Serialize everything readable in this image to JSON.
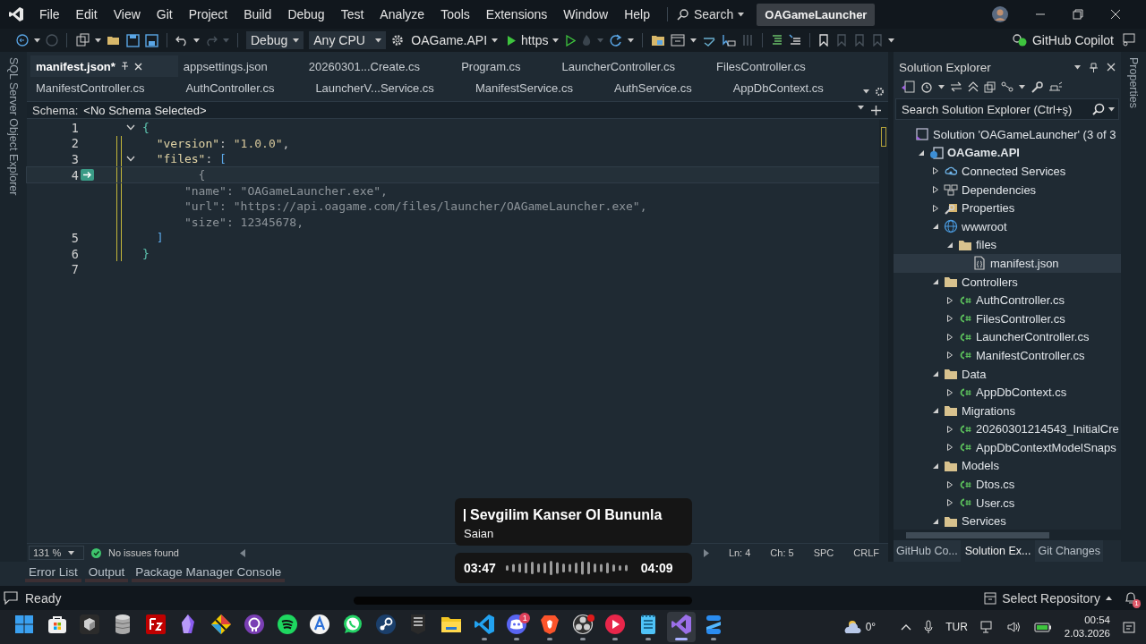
{
  "title_bar": {
    "menu": [
      "File",
      "Edit",
      "View",
      "Git",
      "Project",
      "Build",
      "Debug",
      "Test",
      "Analyze",
      "Tools",
      "Extensions",
      "Window",
      "Help"
    ],
    "search": "Search",
    "solution_name": "OAGameLauncher"
  },
  "toolbar": {
    "configuration": "Debug",
    "platform": "Any CPU",
    "startup_project": "OAGame.API",
    "launch_profile": "https",
    "copilot": "GitHub Copilot"
  },
  "left_strip": "SQL Server Object Explorer",
  "editor_tabs": [
    {
      "label": "manifest.json*",
      "selected": true
    },
    {
      "label": "appsettings.json",
      "selected": false
    },
    {
      "label": "20260301...Create.cs",
      "selected": false
    },
    {
      "label": "Program.cs",
      "selected": false
    },
    {
      "label": "LauncherController.cs",
      "selected": false
    },
    {
      "label": "FilesController.cs",
      "selected": false
    },
    {
      "label": "ManifestController.cs",
      "selected": false
    },
    {
      "label": "AuthController.cs",
      "selected": false
    },
    {
      "label": "LauncherV...Service.cs",
      "selected": false
    },
    {
      "label": "ManifestService.cs",
      "selected": false
    },
    {
      "label": "AuthService.cs",
      "selected": false
    },
    {
      "label": "AppDbContext.cs",
      "selected": false
    }
  ],
  "schema": {
    "label": "Schema:",
    "value": "<No Schema Selected>"
  },
  "code_lines": [
    {
      "number": "1",
      "kind": "code",
      "current": false,
      "changed": false,
      "expanded": true,
      "tokens": [
        {
          "text": "{",
          "kind": "brace"
        }
      ]
    },
    {
      "number": "2",
      "kind": "code",
      "current": false,
      "changed": true,
      "tokens": [
        {
          "text": "  \"version\"",
          "kind": "key"
        },
        {
          "text": ": ",
          "kind": "punct"
        },
        {
          "text": "\"1.0.0\"",
          "kind": "string"
        },
        {
          "text": ",",
          "kind": "punct"
        }
      ]
    },
    {
      "number": "3",
      "kind": "code",
      "current": false,
      "changed": true,
      "expanded": true,
      "tokens": [
        {
          "text": "  \"files\"",
          "kind": "key"
        },
        {
          "text": ": ",
          "kind": "punct"
        },
        {
          "text": "[",
          "kind": "bracket"
        }
      ]
    },
    {
      "number": "4",
      "kind": "suggestion",
      "current": true,
      "changed": true,
      "text": "        {"
    },
    {
      "kind": "suggestion",
      "current": false,
      "changed": true,
      "text": "      \"name\": \"OAGameLauncher.exe\","
    },
    {
      "kind": "suggestion",
      "current": false,
      "changed": true,
      "text": "      \"url\": \"https://api.oagame.com/files/launcher/OAGameLauncher.exe\","
    },
    {
      "kind": "suggestion",
      "current": false,
      "changed": true,
      "text": "      \"size\": 12345678,"
    },
    {
      "number": "5",
      "kind": "code",
      "current": false,
      "changed": true,
      "tokens": [
        {
          "text": "  ]",
          "kind": "bracket"
        }
      ]
    },
    {
      "number": "6",
      "kind": "code",
      "current": false,
      "changed": true,
      "tokens": [
        {
          "text": "}",
          "kind": "brace"
        }
      ]
    },
    {
      "number": "7",
      "kind": "code",
      "current": false,
      "changed": false
    }
  ],
  "editor_status": {
    "zoom": "131 %",
    "issues": "No issues found",
    "line": "Ln: 4",
    "column": "Ch: 5",
    "whitespace": "SPC",
    "line_ending": "CRLF"
  },
  "solution_explorer": {
    "title": "Solution Explorer",
    "search_placeholder": "Search Solution Explorer (Ctrl+ş)",
    "tree": [
      {
        "label": "Solution 'OAGameLauncher' (3 of 3",
        "kind": "solution",
        "selected": false,
        "children": [
          {
            "label": "OAGame.API",
            "kind": "project",
            "expanded": true,
            "selected": false,
            "children": [
              {
                "label": "Connected Services",
                "kind": "cloud",
                "expanded": false,
                "selected": false
              },
              {
                "label": "Dependencies",
                "kind": "deps",
                "expanded": false,
                "selected": false
              },
              {
                "label": "Properties",
                "kind": "wrench",
                "expanded": false,
                "selected": false
              },
              {
                "label": "wwwroot",
                "kind": "globe",
                "expanded": true,
                "selected": false,
                "children": [
                  {
                    "label": "files",
                    "kind": "folder",
                    "expanded": true,
                    "selected": false,
                    "children": [
                      {
                        "label": "manifest.json",
                        "kind": "json",
                        "selected": true
                      }
                    ]
                  }
                ]
              },
              {
                "label": "Controllers",
                "kind": "folder",
                "expanded": true,
                "selected": false,
                "children": [
                  {
                    "label": "AuthController.cs",
                    "kind": "csharp",
                    "expanded": false,
                    "selected": false
                  },
                  {
                    "label": "FilesController.cs",
                    "kind": "csharp",
                    "expanded": false,
                    "selected": false
                  },
                  {
                    "label": "LauncherController.cs",
                    "kind": "csharp",
                    "expanded": false,
                    "selected": false
                  },
                  {
                    "label": "ManifestController.cs",
                    "kind": "csharp",
                    "expanded": false,
                    "selected": false
                  }
                ]
              },
              {
                "label": "Data",
                "kind": "folder",
                "expanded": true,
                "selected": false,
                "children": [
                  {
                    "label": "AppDbContext.cs",
                    "kind": "csharp",
                    "expanded": false,
                    "selected": false
                  }
                ]
              },
              {
                "label": "Migrations",
                "kind": "folder",
                "expanded": true,
                "selected": false,
                "children": [
                  {
                    "label": "20260301214543_InitialCre",
                    "kind": "csharp",
                    "expanded": false,
                    "selected": false
                  },
                  {
                    "label": "AppDbContextModelSnaps",
                    "kind": "csharp",
                    "expanded": false,
                    "selected": false
                  }
                ]
              },
              {
                "label": "Models",
                "kind": "folder",
                "expanded": true,
                "selected": false,
                "children": [
                  {
                    "label": "Dtos.cs",
                    "kind": "csharp",
                    "expanded": false,
                    "selected": false
                  },
                  {
                    "label": "User.cs",
                    "kind": "csharp",
                    "expanded": false,
                    "selected": false
                  }
                ]
              },
              {
                "label": "Services",
                "kind": "folder",
                "expanded": true,
                "selected": false
              }
            ]
          }
        ]
      }
    ],
    "tabs": [
      {
        "label": "GitHub Co...",
        "selected": false
      },
      {
        "label": "Solution Ex...",
        "selected": true
      },
      {
        "label": "Git Changes",
        "selected": false
      }
    ]
  },
  "right_strip": "Properties",
  "bottom_tabs": [
    "Error List",
    "Output",
    "Package Manager Console"
  ],
  "status_bar": {
    "text": "Ready",
    "repository": "Select Repository",
    "notification_count": "1"
  },
  "media_overlay": {
    "title": "Sevgilim Kanser Ol Bununla",
    "artist": "Saian",
    "elapsed": "03:47",
    "total": "04:09"
  },
  "taskbar": {
    "apps": [
      {
        "kind": "windows",
        "selected": false,
        "running": false,
        "alert": false
      },
      {
        "kind": "store",
        "selected": false,
        "running": false,
        "alert": false
      },
      {
        "kind": "cube",
        "selected": false,
        "running": false,
        "alert": false
      },
      {
        "kind": "database",
        "selected": false,
        "running": false,
        "alert": false
      },
      {
        "kind": "ftp",
        "selected": false,
        "running": false,
        "alert": false
      },
      {
        "kind": "crystal",
        "selected": false,
        "running": false,
        "alert": false
      },
      {
        "kind": "diamond",
        "selected": false,
        "running": false,
        "alert": false
      },
      {
        "kind": "octocat",
        "selected": false,
        "running": false,
        "alert": false
      },
      {
        "kind": "music",
        "selected": false,
        "running": false,
        "alert": false
      },
      {
        "kind": "appstore",
        "selected": false,
        "running": false,
        "alert": false
      },
      {
        "kind": "chat",
        "selected": false,
        "running": false,
        "alert": false
      },
      {
        "kind": "steam",
        "selected": false,
        "running": false,
        "alert": false
      },
      {
        "kind": "epic",
        "selected": false,
        "running": false,
        "alert": false
      },
      {
        "kind": "folder",
        "selected": false,
        "running": false,
        "alert": false
      },
      {
        "kind": "vscode",
        "selected": false,
        "running": true,
        "alert": false
      },
      {
        "kind": "discord",
        "selected": false,
        "running": true,
        "alert": false,
        "badge": "1"
      },
      {
        "kind": "brave",
        "selected": false,
        "running": true,
        "alert": false
      },
      {
        "kind": "obs",
        "selected": false,
        "running": true,
        "alert": true
      },
      {
        "kind": "player",
        "selected": false,
        "running": true,
        "alert": false
      },
      {
        "kind": "notepad",
        "selected": false,
        "running": true,
        "alert": false
      },
      {
        "kind": "visualstudio",
        "selected": true,
        "running": true,
        "alert": false
      },
      {
        "kind": "stack",
        "selected": false,
        "running": true,
        "alert": false
      }
    ],
    "weather": "0°",
    "language": "TUR",
    "time": "00:54",
    "date": "2.03.2026"
  }
}
